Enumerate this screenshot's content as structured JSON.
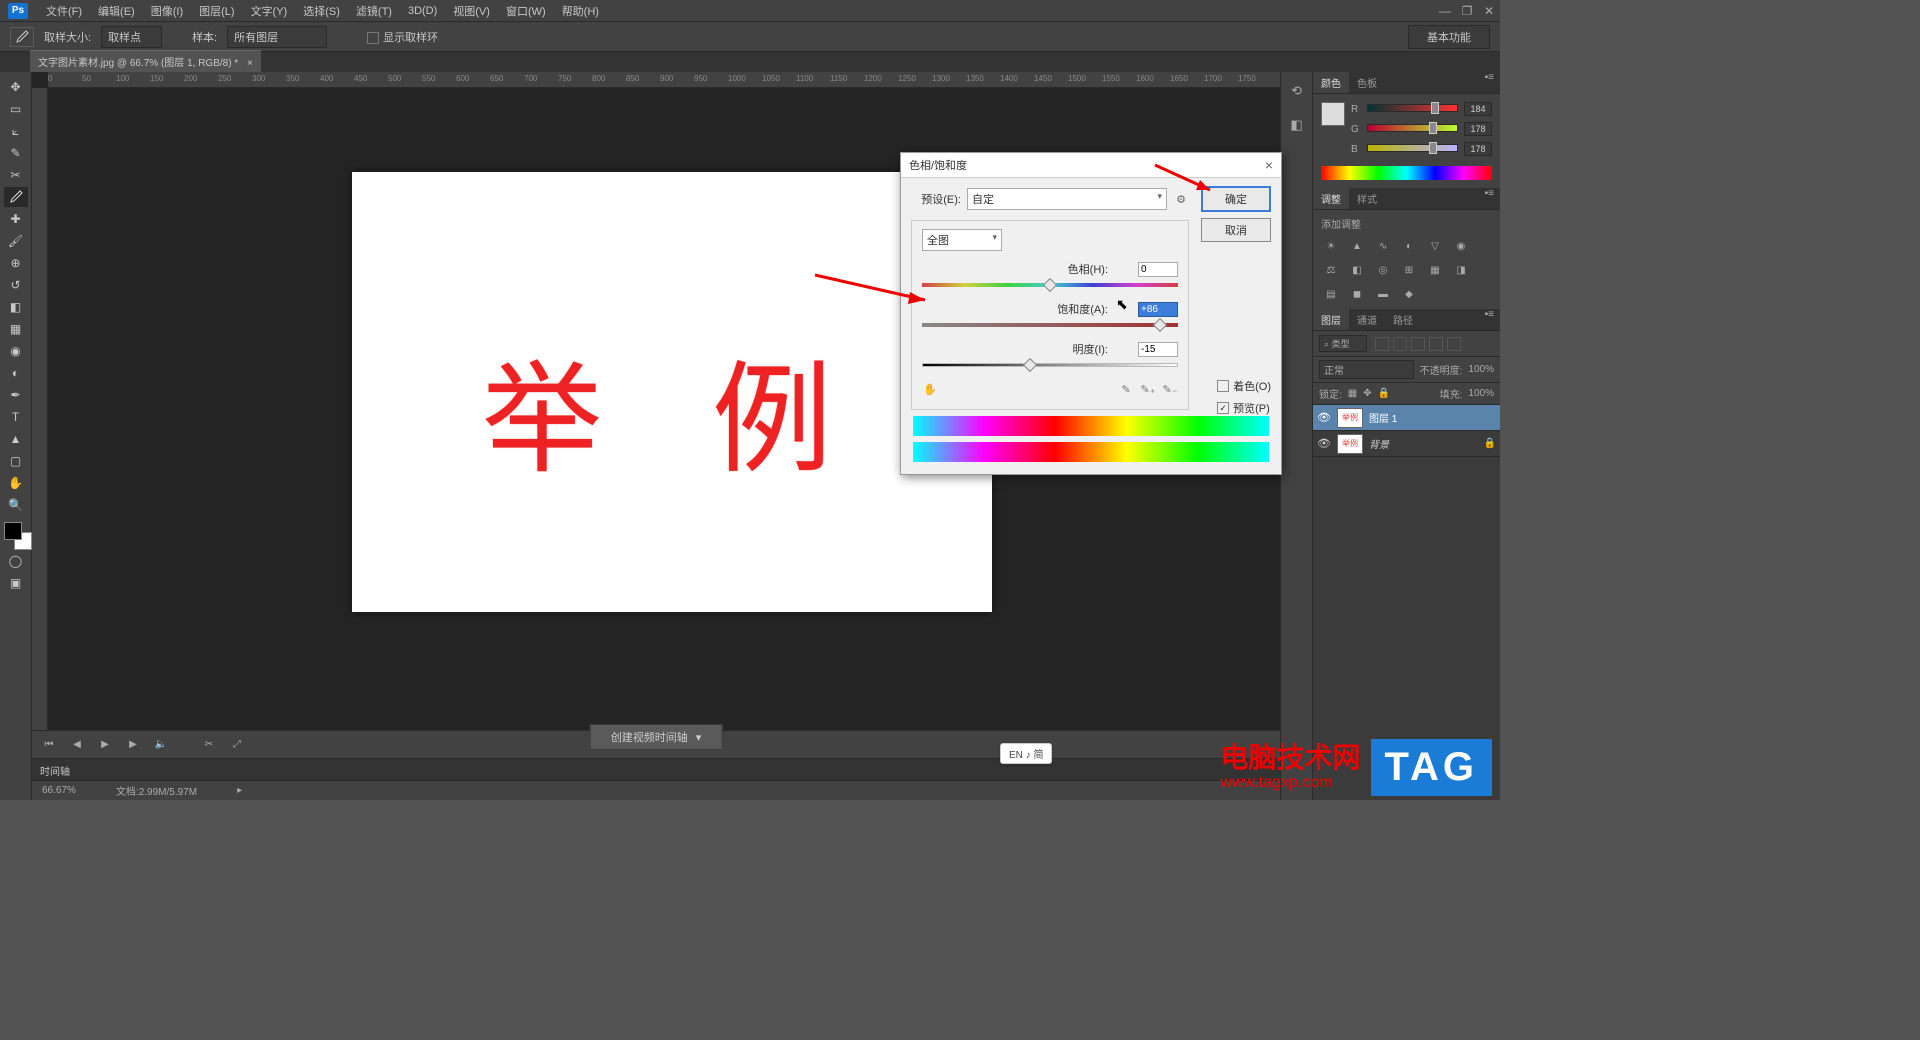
{
  "menubar": {
    "logo": "Ps",
    "items": [
      "文件(F)",
      "编辑(E)",
      "图像(I)",
      "图层(L)",
      "文字(Y)",
      "选择(S)",
      "滤镜(T)",
      "3D(D)",
      "视图(V)",
      "窗口(W)",
      "帮助(H)"
    ]
  },
  "optionsbar": {
    "sample_size_label": "取样大小:",
    "sample_size_value": "取样点",
    "sample_label": "样本:",
    "sample_value": "所有图层",
    "show_ring_label": "显示取样环",
    "workspace": "基本功能"
  },
  "doc_tab": "文字图片素材.jpg @ 66.7% (图层 1, RGB/8) *",
  "ruler_ticks": [
    "0",
    "50",
    "100",
    "150",
    "200",
    "250",
    "300",
    "350",
    "400",
    "450",
    "500",
    "550",
    "600",
    "650",
    "700",
    "750",
    "800",
    "850",
    "900",
    "950",
    "1000",
    "1050",
    "1100",
    "1150",
    "1200",
    "1250",
    "1300",
    "1350",
    "1400",
    "1450",
    "1500",
    "1550",
    "1600",
    "1650",
    "1700",
    "1750"
  ],
  "canvas_text": "举 例",
  "status": {
    "zoom": "66.67%",
    "docinfo": "文档:2.99M/5.97M"
  },
  "timeline_label": "时间轴",
  "create_timeline": "创建视频时间轴",
  "ime": "EN ♪ 简",
  "right_panels": {
    "color": {
      "tabs": [
        "颜色",
        "色板"
      ],
      "channels": [
        {
          "label": "R",
          "val": "184",
          "grad": "linear-gradient(90deg,#003232,#ff3232)"
        },
        {
          "label": "G",
          "val": "178",
          "grad": "linear-gradient(90deg,#b80032,#b8ff32)"
        },
        {
          "label": "B",
          "val": "178",
          "grad": "linear-gradient(90deg,#b8b200,#b8b2ff)"
        }
      ]
    },
    "adjust": {
      "tabs": [
        "调整",
        "样式"
      ],
      "heading": "添加调整"
    },
    "layers": {
      "tabs": [
        "图层",
        "通道",
        "路径"
      ],
      "filter": "⌕ 类型",
      "blend_mode": "正常",
      "opacity_label": "不透明度:",
      "opacity_val": "100%",
      "lock_label": "锁定:",
      "fill_label": "填充:",
      "fill_val": "100%",
      "items": [
        {
          "name": "图层 1",
          "selected": true,
          "locked": false
        },
        {
          "name": "背景",
          "selected": false,
          "locked": true
        }
      ]
    }
  },
  "dialog": {
    "title": "色相/饱和度",
    "preset_label": "预设(E):",
    "preset_value": "自定",
    "range_value": "全图",
    "hue_label": "色相(H):",
    "hue_value": "0",
    "sat_label": "饱和度(A):",
    "sat_value": "+86",
    "light_label": "明度(I):",
    "light_value": "-15",
    "colorize_label": "着色(O)",
    "preview_label": "预览(P)",
    "ok": "确定",
    "cancel": "取消"
  },
  "watermark": {
    "line1": "电脑技术网",
    "line2": "www.tagxp.com",
    "tag": "TAG"
  }
}
